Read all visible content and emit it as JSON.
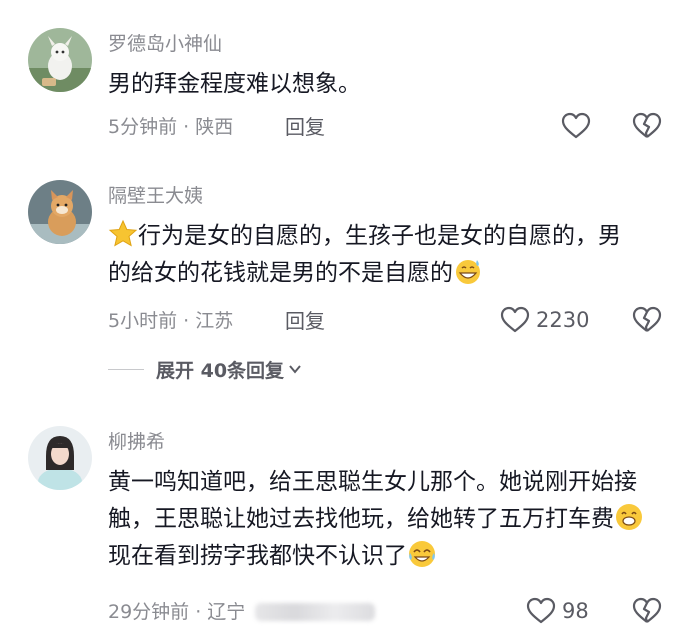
{
  "comments": [
    {
      "username": "罗德岛小神仙",
      "text_parts": [
        "男的拜金程度难以想象。"
      ],
      "meta": "5分钟前 · 陕西",
      "reply_label": "回复",
      "like_count": "",
      "avatar": "goat-plush-icon"
    },
    {
      "username": "隔壁王大姨",
      "text_parts": [
        "行为是女的自愿的，生孩子也是女的自愿的，男的给女的花钱就是男的不是自愿的"
      ],
      "meta": "5小时前 · 江苏",
      "reply_label": "回复",
      "like_count": "2230",
      "avatar": "cat-icon"
    },
    {
      "username": "柳拂希",
      "text_parts": [
        "黄一鸣知道吧，给王思聪生女儿那个。她说刚开始接触，王思聪让她过去找他玩，给她转了五万打车费",
        "现在看到捞字我都快不认识了"
      ],
      "meta": "29分钟前 · 辽宁",
      "reply_label": "",
      "like_count": "98",
      "avatar": "woman-portrait-icon"
    }
  ],
  "expand_replies": "展开 40条回复",
  "colors": {
    "text": "#161823",
    "muted": "#8a8b91",
    "action": "#5a5b63"
  }
}
